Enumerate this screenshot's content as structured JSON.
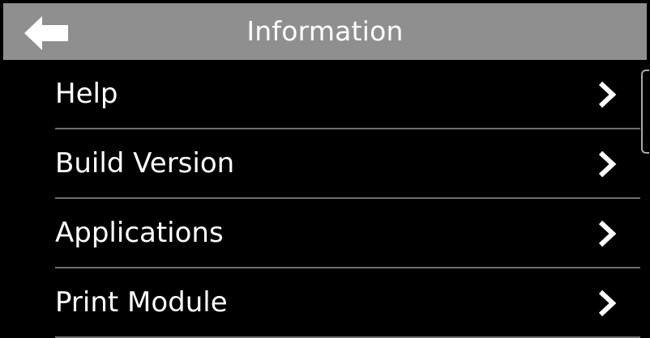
{
  "header": {
    "title": "Information",
    "back_icon": "back-arrow-icon"
  },
  "menu": {
    "items": [
      {
        "label": "Help",
        "icon": "chevron-right-icon"
      },
      {
        "label": "Build Version",
        "icon": "chevron-right-icon"
      },
      {
        "label": "Applications",
        "icon": "chevron-right-icon"
      },
      {
        "label": "Print Module",
        "icon": "chevron-right-icon"
      }
    ]
  },
  "colors": {
    "header_bg": "#8f8f8f",
    "background": "#000000",
    "text": "#ffffff",
    "divider": "#6e6e6e"
  }
}
